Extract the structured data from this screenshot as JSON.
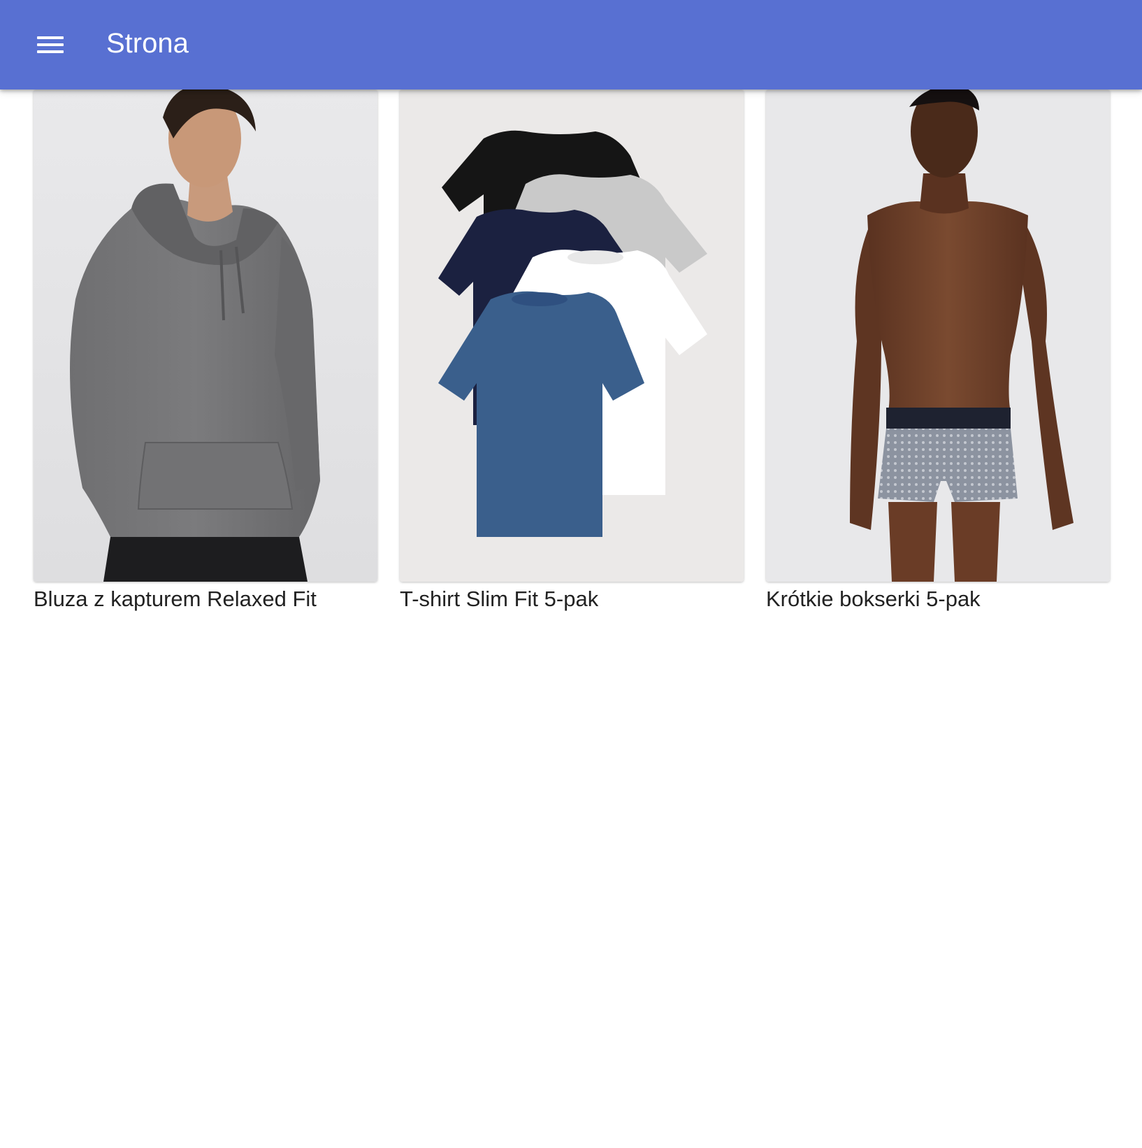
{
  "appbar": {
    "title": "Strona",
    "menu_icon": "menu-icon",
    "background_color": "#5870d2"
  },
  "products": [
    {
      "name": "Bluza z kapturem Relaxed Fit",
      "image": "grey-hoodie-model-photo"
    },
    {
      "name": "T-shirt Slim Fit 5-pak",
      "image": "five-tshirts-flatlay-photo"
    },
    {
      "name": "Krótkie bokserki 5-pak",
      "image": "boxer-briefs-model-photo"
    }
  ]
}
